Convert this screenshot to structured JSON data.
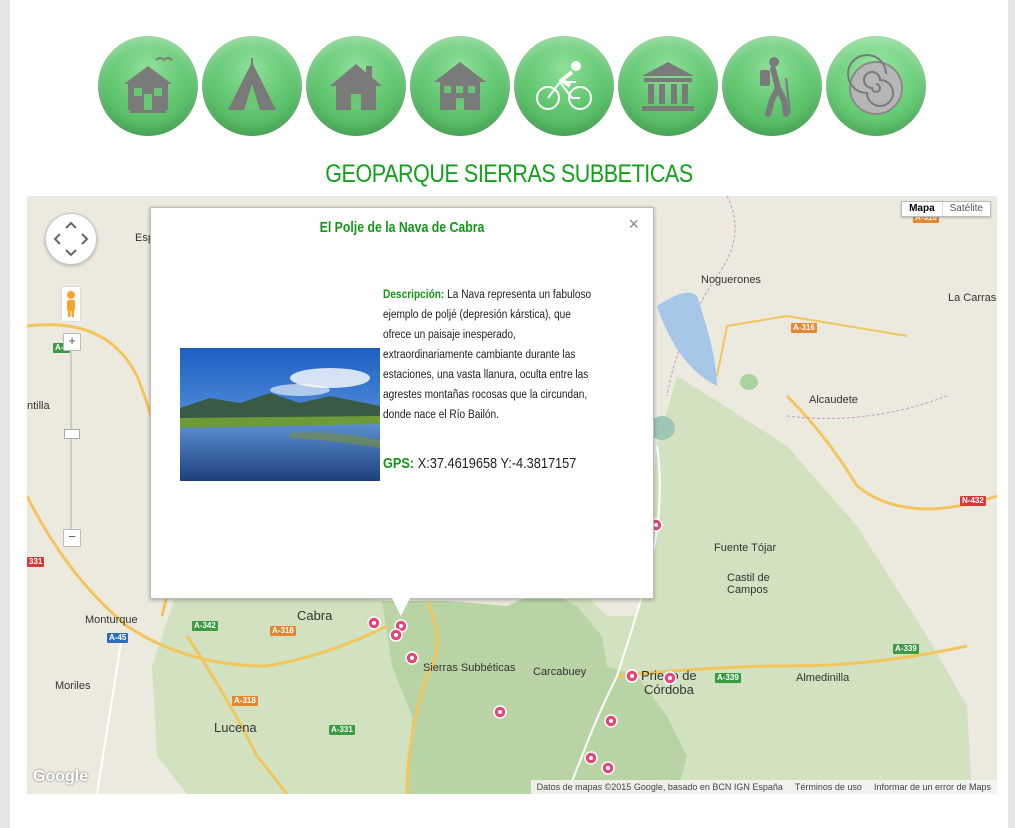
{
  "categories": [
    {
      "name": "casas-rurales",
      "icon": "rural-house-icon"
    },
    {
      "name": "camping",
      "icon": "tent-icon"
    },
    {
      "name": "casas",
      "icon": "house-icon"
    },
    {
      "name": "hoteles",
      "icon": "hotel-icon"
    },
    {
      "name": "ciclismo",
      "icon": "cyclist-icon"
    },
    {
      "name": "museos",
      "icon": "museum-icon"
    },
    {
      "name": "senderismo",
      "icon": "hiker-icon"
    },
    {
      "name": "geologia",
      "icon": "ammonite-fossil-icon"
    }
  ],
  "page_title": "GEOPARQUE SIERRAS SUBBETICAS",
  "map": {
    "type_map": "Mapa",
    "type_satellite": "Satélite",
    "logo": "Google",
    "attribution": "Datos de mapas ©2015 Google, basado en BCN IGN España",
    "terms": "Términos de uso",
    "report": "Informar de un error de Maps",
    "places": {
      "noguerones": "Noguerones",
      "la_carras": "La Carras",
      "alcaudete": "Alcaudete",
      "fuente_tojar": "Fuente Tójar",
      "castil_de": "Castil de",
      "campos": "Campos",
      "cabra": "Cabra",
      "monturque": "Monturque",
      "moriles": "Moriles",
      "lucena": "Lucena",
      "carcabuey": "Carcabuey",
      "priego": "Priego de",
      "cordoba": "Córdoba",
      "almedinilla": "Almedinilla",
      "sierras_subbeticas": "Sierras Subbéticas",
      "esp": "Esp",
      "ntilla": "ntilla"
    },
    "roads": {
      "a316_top": "A-316",
      "a316_mid": "A-316",
      "n432": "N-432",
      "a339_right": "A-339",
      "a339_mid": "A-339",
      "a342": "A-342",
      "a318_a": "A-318",
      "a318_b": "A-318",
      "a45": "A-45",
      "a331": "A-331",
      "a331_left": "331",
      "a3_left": "A-3"
    }
  },
  "info_window": {
    "title": "El Polje de la Nava de Cabra",
    "description_label": "Descripción:",
    "description": "La Nava representa un fabuloso ejemplo de poljé (depresión kárstica), que ofrece un paisaje inesperado, extraordinariamente cambiante durante las estaciones, una vasta llanura, oculta entre las agrestes montañas rocosas que la circundan, donde nace el Río Bailón.",
    "gps_label": "GPS:",
    "gps": "X:37.4619658 Y:-4.3817157",
    "close": "×"
  }
}
